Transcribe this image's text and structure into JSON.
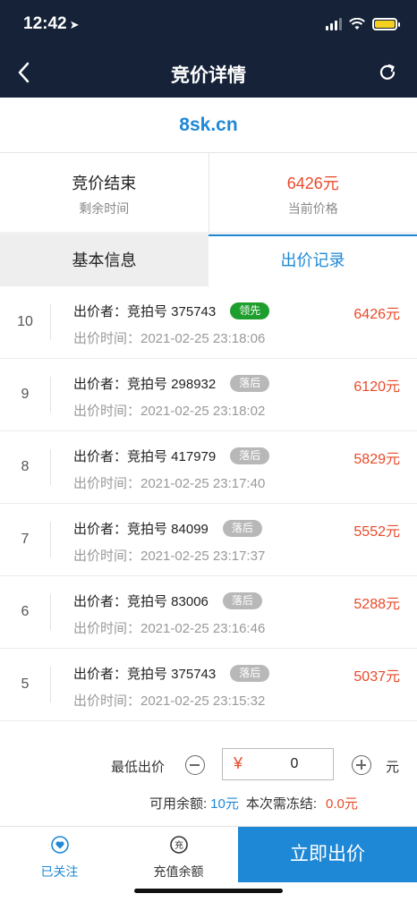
{
  "status": {
    "time": "12:42"
  },
  "nav": {
    "title": "竞价详情"
  },
  "domain": "8sk.cn",
  "summary": {
    "status_main": "竞价结束",
    "status_sub": "剩余时间",
    "price_main": "6426元",
    "price_sub": "当前价格"
  },
  "tabs": [
    {
      "label": "基本信息"
    },
    {
      "label": "出价记录"
    }
  ],
  "records": [
    {
      "index": "10",
      "bidder": "出价者：竞拍号 375743",
      "badge": "领先",
      "time": "出价时间：2021-02-25 23:18:06",
      "amount": "6426元"
    },
    {
      "index": "9",
      "bidder": "出价者：竞拍号 298932",
      "badge": "落后",
      "time": "出价时间：2021-02-25 23:18:02",
      "amount": "6120元"
    },
    {
      "index": "8",
      "bidder": "出价者：竞拍号 417979",
      "badge": "落后",
      "time": "出价时间：2021-02-25 23:17:40",
      "amount": "5829元"
    },
    {
      "index": "7",
      "bidder": "出价者：竞拍号 84099",
      "badge": "落后",
      "time": "出价时间：2021-02-25 23:17:37",
      "amount": "5552元"
    },
    {
      "index": "6",
      "bidder": "出价者：竞拍号 83006",
      "badge": "落后",
      "time": "出价时间：2021-02-25 23:16:46",
      "amount": "5288元"
    },
    {
      "index": "5",
      "bidder": "出价者：竞拍号 375743",
      "badge": "落后",
      "time": "出价时间：2021-02-25 23:15:32",
      "amount": "5037元"
    }
  ],
  "bid": {
    "min_label": "最低出价",
    "currency": "¥",
    "value": "0",
    "unit": "元",
    "balance_label": "可用余额:",
    "balance_value": "10元",
    "freeze_label": "本次需冻结:",
    "freeze_value": "0.0元"
  },
  "bottom": {
    "follow_label": "已关注",
    "recharge_label": "充值余额",
    "bid_button": "立即出价"
  },
  "colors": {
    "accent": "#1e88d6",
    "price": "#e94a2a",
    "lead": "#1e9e2c",
    "behind": "#b8b8b8",
    "topbar": "#152238"
  }
}
